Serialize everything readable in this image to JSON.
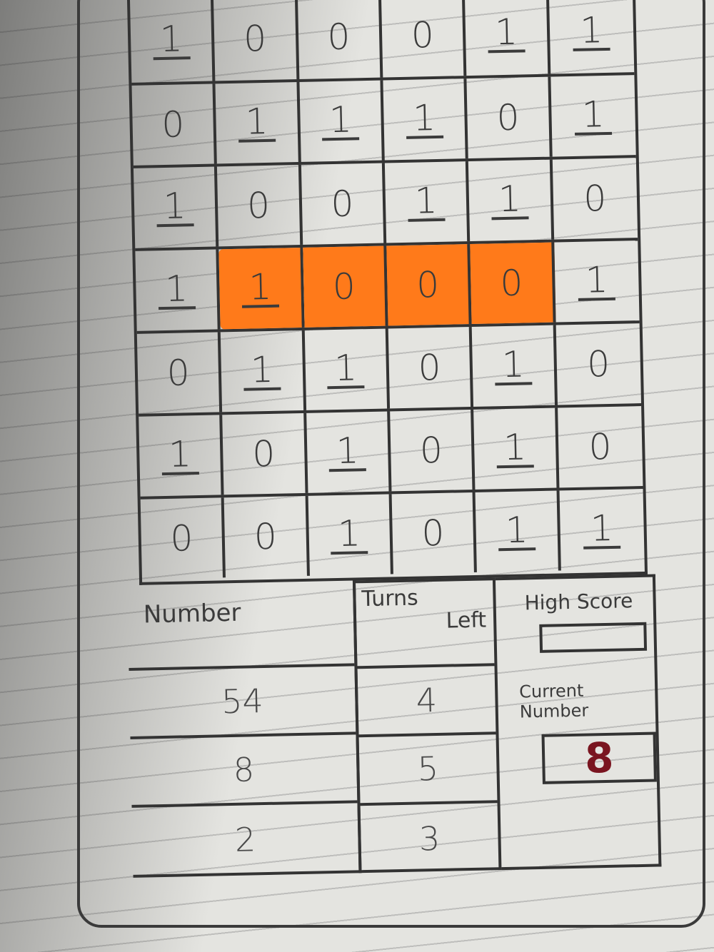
{
  "board": [
    [
      "1",
      "0",
      "0",
      "0",
      "1",
      "1"
    ],
    [
      "0",
      "1",
      "1",
      "1",
      "0",
      "1"
    ],
    [
      "1",
      "0",
      "0",
      "1",
      "1",
      "0"
    ],
    [
      "1",
      "1",
      "0",
      "0",
      "0",
      "1"
    ],
    [
      "0",
      "1",
      "1",
      "0",
      "1",
      "0"
    ],
    [
      "1",
      "0",
      "1",
      "0",
      "1",
      "0"
    ],
    [
      "0",
      "0",
      "1",
      "0",
      "1",
      "1"
    ]
  ],
  "highlight": {
    "row": 3,
    "from_col": 1,
    "to_col": 4,
    "color": "#ff7a1a"
  },
  "numbers": {
    "header": "Number",
    "items": [
      "54",
      "8",
      "2"
    ]
  },
  "turns": {
    "header_line1": "Turns",
    "header_line2": "Left",
    "items": [
      "4",
      "5",
      "3"
    ]
  },
  "high_score": {
    "label": "High Score",
    "value": ""
  },
  "current_number": {
    "label": "Current Number",
    "value": "8",
    "color": "#7a1520"
  }
}
